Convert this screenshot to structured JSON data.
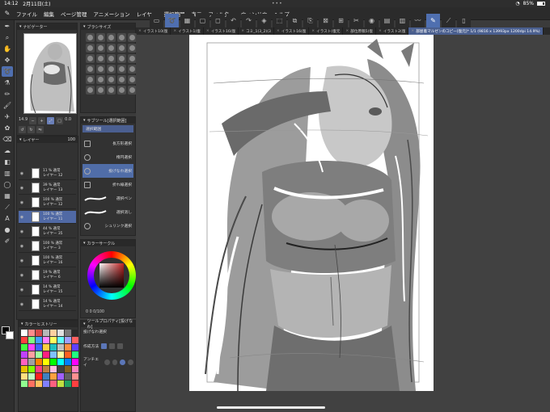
{
  "status": {
    "time": "14:12",
    "date": "2月11日(土)",
    "battery": "85%"
  },
  "menu": [
    "ファイル",
    "編集",
    "ページ管理",
    "アニメーション",
    "レイヤー",
    "選択範囲",
    "表示",
    "フィルター",
    "ウィンドウ",
    "ヘルプ"
  ],
  "tabs": [
    {
      "label": "イラスト10(復"
    },
    {
      "label": "イラスト1(復"
    },
    {
      "label": "イラスト16(復"
    },
    {
      "label": "コミ_1(3_2)(3"
    },
    {
      "label": "イラスト16(復"
    },
    {
      "label": "イラスト(復元"
    },
    {
      "label": "部位原稿5(復"
    },
    {
      "label": "イラスト2(復"
    },
    {
      "label": "部屋着マルゼンのコピー[復元]* 1/1 (9816 x 13993px 1200dpi 14.9%)"
    }
  ],
  "panels": {
    "navigator": "ナビゲーター",
    "brushsize": "ブラシサイズ",
    "subtool": "サブツール[選択範囲]",
    "layer": "レイヤー",
    "colorcircle": "カラーサークル",
    "colorhistory": "カラーヒストリー",
    "toolprops": "ツールプロパティ[投げなわ]"
  },
  "navigator": {
    "zoom": "14.9",
    "rotation": "0.0"
  },
  "subtool": {
    "group": "選択範囲",
    "items": [
      "長方形選択",
      "楕円選択",
      "投げなわ選択",
      "折れ線選択",
      "選択ペン",
      "選択消し",
      "シュリンク選択"
    ],
    "active_index": 2
  },
  "layer": {
    "opacity": "100",
    "rows": [
      {
        "mode": "11 % 通常",
        "name": "レイヤー 12"
      },
      {
        "mode": "39 % 通常",
        "name": "レイヤー 13"
      },
      {
        "mode": "100 % 通常",
        "name": "レイヤー 12"
      },
      {
        "mode": "100 % 通常",
        "name": "レイヤー 11"
      },
      {
        "mode": "44 % 通常",
        "name": "レイヤー 35"
      },
      {
        "mode": "100 % 通常",
        "name": "レイヤー 3"
      },
      {
        "mode": "100 % 通常",
        "name": "レイヤー 16"
      },
      {
        "mode": "19 % 通常",
        "name": "レイヤー 6"
      },
      {
        "mode": "14 % 通常",
        "name": "レイヤー 15"
      },
      {
        "mode": "14 % 通常",
        "name": "レイヤー 14"
      }
    ],
    "active_index": 3
  },
  "colorcircle": {
    "values": "0  0  0/100"
  },
  "toolprops": {
    "tool": "投げなわ選択",
    "mode_label": "作成方法",
    "aa_label": "アンチエイ"
  },
  "colors": {
    "accent": "#4f6fb0",
    "history": [
      "#ffffff",
      "#ff8c8c",
      "#d84a4a",
      "#b8b8b8",
      "#ffd0a0",
      "#e0e0e0",
      "#7a7a7a",
      "#2a2a2a",
      "#ff4040",
      "#80ff80",
      "#40a0ff",
      "#ff80ff",
      "#ffff60",
      "#60ffff",
      "#a0a0ff",
      "#ff6060",
      "#40ff40",
      "#ff40ff",
      "#4060ff",
      "#ffd040",
      "#20c0c0",
      "#c0c0c0",
      "#ff9040",
      "#6040ff",
      "#c040ff",
      "#ffa0a0",
      "#a0ffa0",
      "#ff2080",
      "#80c0ff",
      "#ffffa0",
      "#ff6020",
      "#20ff80",
      "#ff60c0",
      "#a0a0a0",
      "#ff8000",
      "#ffff00",
      "#00ff00",
      "#00ffff",
      "#0080ff",
      "#ff00ff",
      "#e8c000",
      "#80ff00",
      "#ff4080",
      "#c08040",
      "#ffc0e0",
      "#404040",
      "#806020",
      "#ff80c0",
      "#ffe080",
      "#c0ffc0",
      "#ff2020",
      "#4080c0",
      "#ffa040",
      "#a060ff",
      "#606060",
      "#ff9090",
      "#90ff90",
      "#ff7060",
      "#ffc060",
      "#8080ff",
      "#ff6080",
      "#c0e040",
      "#20a060",
      "#ff4040"
    ]
  },
  "icons": {
    "tools": [
      "pen-icon",
      "zoom-icon",
      "move-icon",
      "hand-icon",
      "lasso-icon",
      "eyedropper-icon",
      "pencil-icon",
      "brush-icon",
      "airbrush-icon",
      "eraser-icon",
      "fill-icon",
      "gradient-icon",
      "figure-icon",
      "ruler-icon",
      "text-icon",
      "balloon-icon",
      "correct-line-icon"
    ],
    "commands": [
      "selection-icon",
      "lasso-active-icon",
      "undo-icon",
      "redo-icon",
      "cut-icon",
      "copy-icon",
      "paste-icon",
      "transform-icon",
      "deselect-icon",
      "fill-selection-icon",
      "brush-stabilizer-icon",
      "reference-icon",
      "pen-pressure-icon",
      "timelapse-icon"
    ]
  }
}
